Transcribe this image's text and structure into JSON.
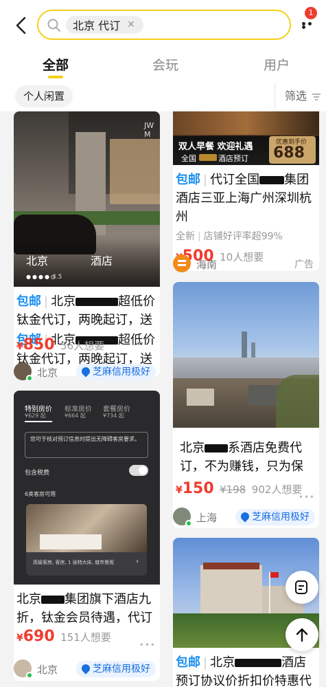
{
  "search": {
    "chip_text": "北京 代订"
  },
  "notification_count": "1",
  "tabs": [
    {
      "label": "全部"
    },
    {
      "label": "会玩"
    },
    {
      "label": "用户"
    }
  ],
  "filters": {
    "pill": "个人闲置",
    "filter_label": "筛选"
  },
  "cards": {
    "c1": {
      "image_caption_left": "北京",
      "image_caption_right": "酒店",
      "image_sign": "JW M",
      "image_rating": "4.5",
      "tag": "包邮",
      "title_a": "北京",
      "title_b": "超低价钛金代订，两晚起订，送",
      "price_symbol": "¥",
      "price": "850",
      "want": "56人想要",
      "location": "北京",
      "credit": "芝麻信用极好"
    },
    "c2": {
      "banner_left": "双人早餐  欢迎礼遇",
      "banner_sub": "全国",
      "banner_sub2": "酒店预订",
      "banner_offer": "优惠到手价",
      "banner_price": "688",
      "tag": "包邮",
      "title_a": "代订全国",
      "title_b": "集团酒店三亚上海广州深圳杭州",
      "meta_a": "全新",
      "meta_b": "店铺好评率超99%",
      "price_symbol": "¥",
      "price": "500",
      "want": "10人想要",
      "ad_location": "海南",
      "ad_label": "广告"
    },
    "c3": {
      "title_a": "北京",
      "title_b": "系酒店免费代订，不为赚钱，只为保",
      "price_symbol": "¥",
      "price": "150",
      "orig": "¥198",
      "want": "902人想要",
      "location": "上海",
      "credit": "芝麻信用极好"
    },
    "c4": {
      "tabs": [
        "特别房价",
        "标准房价",
        "套餐房价"
      ],
      "tab_prices": [
        "¥629 起",
        "¥664 起",
        "¥734 起"
      ],
      "notice": "您可于核对预订信息时提出无障碍客房要求。",
      "toggle_label": "包含税费",
      "room_count": "6类客房可用",
      "room_desc": "高级客房, 客房, 1 张特大床, 城市景观",
      "title_a": "北京",
      "title_b": "集团旗下酒店九折，钛金会员待遇，代订",
      "price_symbol": "¥",
      "price": "690",
      "want": "151人想要",
      "location": "北京",
      "credit": "芝麻信用极好"
    },
    "c5": {
      "tag": "包邮",
      "title_a": "北京",
      "title_b": "酒店预订协议价折扣价特惠代订"
    }
  },
  "colors": {
    "accent": "#f5d01a",
    "price": "#f03c2e",
    "blue": "#1a8ff0"
  }
}
